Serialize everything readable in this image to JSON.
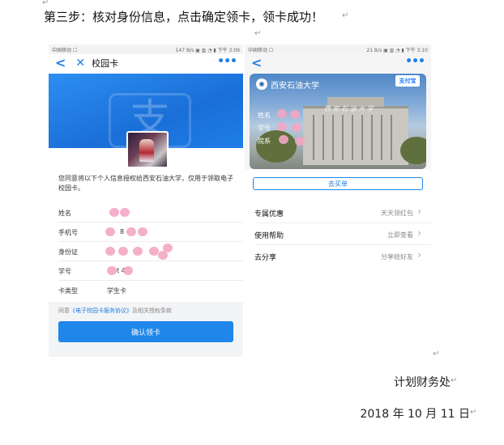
{
  "heading": "第三步：核对身份信息，点击确定领卡，领卡成功！",
  "left_phone": {
    "status_left": "中国移动 ☐",
    "status_right": "147 B/s ▣ ▥ ◔ ▮ 下午 3:09",
    "nav_title": "校园卡",
    "banner_glyph": "支",
    "consent": "您同意将以下个人信息授权给西安石油大学，仅用于领取电子校园卡。",
    "fields": [
      {
        "label": "姓名",
        "value": ""
      },
      {
        "label": "手机号",
        "value": "8"
      },
      {
        "label": "身份证",
        "value": ""
      },
      {
        "label": "学号",
        "value": "t 4"
      },
      {
        "label": "卡类型",
        "value": "学生卡"
      }
    ],
    "agree_prefix": "同意",
    "agree_link": "《电子校园卡服务协议》",
    "agree_suffix": "及相关授权条款",
    "confirm_label": "确认领卡"
  },
  "right_phone": {
    "status_left": "中国移动 ☐",
    "status_right": "21 B/s ▣ ▥ ◔ ▮ 下午 3:10",
    "school_name": "西安石油大学",
    "alipay_label": "支付宝",
    "card_engraving": "西 安 石 油 大 学",
    "card_labels": [
      "姓名",
      "学号",
      "院系"
    ],
    "buy_label": "去买单",
    "menu": [
      {
        "title": "专属优惠",
        "hint": "天天领红包"
      },
      {
        "title": "使用帮助",
        "hint": "立即查看"
      },
      {
        "title": "去分享",
        "hint": "分享给好友"
      }
    ]
  },
  "signature": {
    "department": "计划财务处",
    "date": "2018 年 10 月 11 日"
  }
}
